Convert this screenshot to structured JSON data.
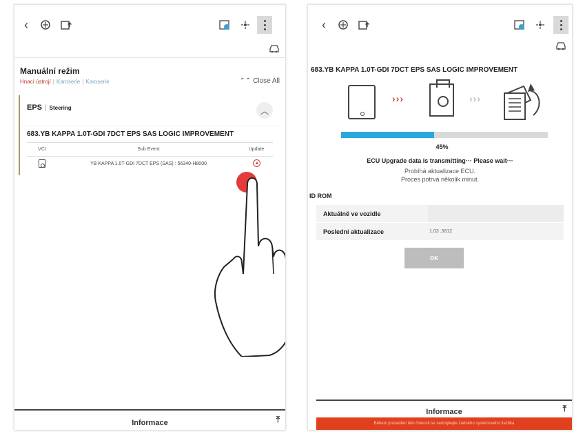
{
  "left_panel": {
    "mode_title": "Manuální režim",
    "breadcrumb": [
      "Hnací ústrojí",
      "Karoserie",
      "Karoserie"
    ],
    "breadcrumb_sep": "|",
    "close_all": "Close All",
    "eps_label": "EPS",
    "eps_sub": "Steering",
    "event_title": "683.YB KAPPA 1.0T-GDI 7DCT EPS SAS LOGIC IMPROVEMENT",
    "table": {
      "headers": [
        "VCI",
        "Sub Event",
        "Update"
      ],
      "rows": [
        {
          "sub_event": "YB KAPPA 1.0T-GDI 7DCT EPS (SAS) : 56340-H8000"
        }
      ]
    },
    "footer": "Informace"
  },
  "right_panel": {
    "event_title": "683.YB KAPPA 1.0T-GDI 7DCT EPS SAS LOGIC IMPROVEMENT",
    "flow_arrows": "›››",
    "progress": 0.45,
    "progress_text": "45%",
    "status_main": "ECU Upgrade data is transmitting··· Please wait···",
    "status_cz1": "Probíhá aktualizace ECU.",
    "status_cz2": "Proces potrvá několik minut.",
    "idrom_title": "ID ROM",
    "rom_rows": [
      {
        "label": "Aktuálně ve vozidle",
        "value": ""
      },
      {
        "label": "Poslední aktualizace",
        "value": "1.03 .5812"
      }
    ],
    "ok_button": "OK",
    "footer": "Informace",
    "warning": "Během provádění této činnosti se nedotýkejte žádného systémového tlačítka"
  },
  "colors": {
    "accent_red": "#e33b3b",
    "progress_blue": "#29a8dc",
    "warning_bar": "#e1401f"
  }
}
